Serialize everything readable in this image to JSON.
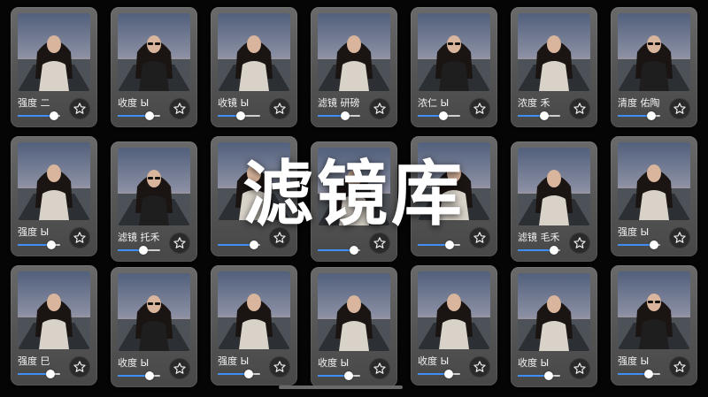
{
  "title": "滤镜库",
  "colors": {
    "accent": "#3f8ef5",
    "card": "#5a5a5a",
    "background": "#050505"
  },
  "filters": [
    {
      "label": "强度 二",
      "value": 0.85,
      "person": "light"
    },
    {
      "label": "收度 Ы",
      "value": 0.75,
      "person": "dark"
    },
    {
      "label": "收镜 Ы",
      "value": 0.55,
      "person": "light"
    },
    {
      "label": "滤镜 研磅",
      "value": 0.65,
      "person": "light"
    },
    {
      "label": "浓仁 Ы",
      "value": 0.6,
      "person": "dark"
    },
    {
      "label": "浓度 禾",
      "value": 0.62,
      "person": "light"
    },
    {
      "label": "清度 佑陶",
      "value": 0.8,
      "person": "dark"
    },
    {
      "label": "强度 Ы",
      "value": 0.8,
      "person": "light"
    },
    {
      "label": "滤镜 托禾",
      "value": 0.6,
      "person": "dark"
    },
    {
      "label": "",
      "value": 0.85,
      "person": "light"
    },
    {
      "label": "",
      "value": 0.85,
      "person": "light"
    },
    {
      "label": "",
      "value": 0.75,
      "person": "light"
    },
    {
      "label": "滤镜 毛禾",
      "value": 0.85,
      "person": "light"
    },
    {
      "label": "强度 Ы",
      "value": 0.85,
      "person": "light"
    },
    {
      "label": "强度 巳",
      "value": 0.78,
      "person": "light"
    },
    {
      "label": "收度 Ы",
      "value": 0.75,
      "person": "dark"
    },
    {
      "label": "强度 Ы",
      "value": 0.72,
      "person": "light"
    },
    {
      "label": "收度 Ы",
      "value": 0.72,
      "person": "light"
    },
    {
      "label": "收度 Ы",
      "value": 0.72,
      "person": "light"
    },
    {
      "label": "收度 Ы",
      "value": 0.72,
      "person": "light"
    },
    {
      "label": "强度 Ы",
      "value": 0.72,
      "person": "dark"
    }
  ]
}
